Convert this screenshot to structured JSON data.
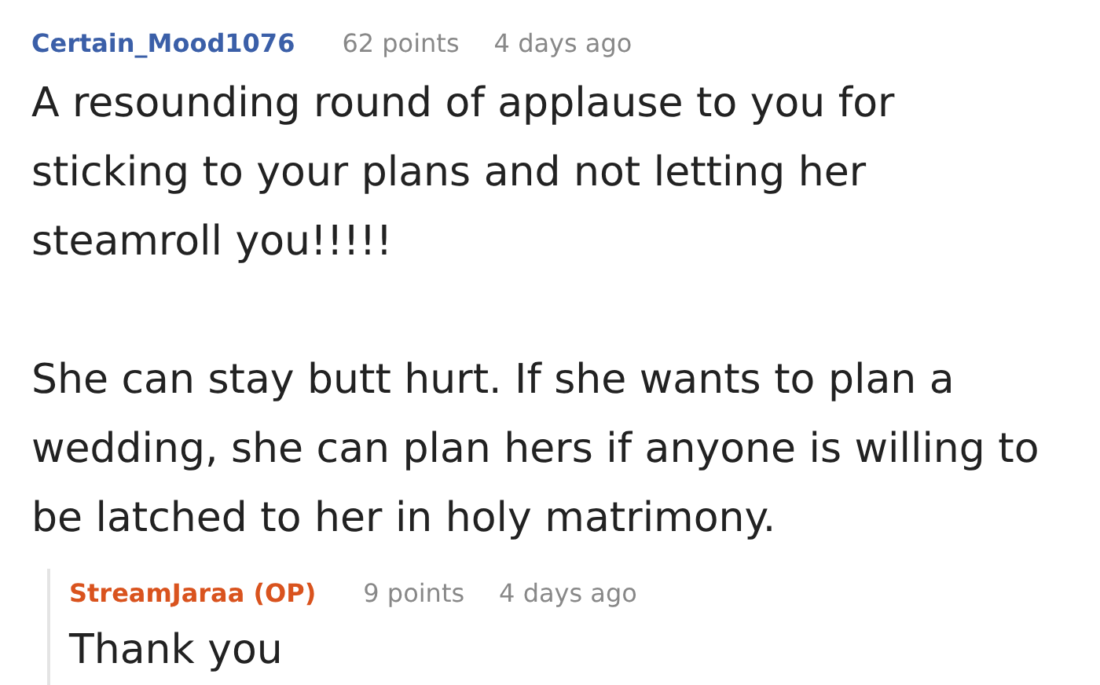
{
  "comment": {
    "author": "Certain_Mood1076",
    "kind": "user",
    "points": "62 points",
    "time": "4 days ago",
    "paragraphs": [
      "A resounding round of applause to you for sticking to your plans and not letting her steamroll you!!!!!",
      "She can stay butt hurt. If she wants to plan a wedding, she can plan hers if anyone is willing to be latched to her in holy matrimony."
    ]
  },
  "reply": {
    "author": "StreamJaraa (OP)",
    "kind": "op",
    "points": "9 points",
    "time": "4 days ago",
    "paragraphs": [
      "Thank you"
    ]
  }
}
